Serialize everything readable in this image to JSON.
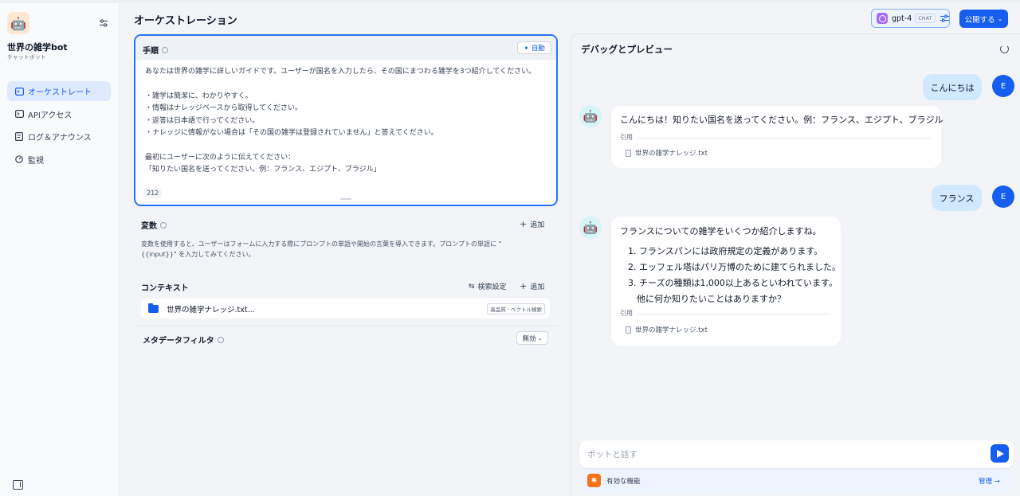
{
  "app": {
    "name": "世界の雑学bot",
    "type": "チャットボット"
  },
  "sidebar": {
    "items": [
      {
        "label": "オーケストレート",
        "active": true,
        "icon": "terminal-square-icon"
      },
      {
        "label": "APIアクセス",
        "active": false,
        "icon": "terminal-icon"
      },
      {
        "label": "ログ＆アナウンス",
        "active": false,
        "icon": "file-list-icon"
      },
      {
        "label": "監視",
        "active": false,
        "icon": "dashboard-icon"
      }
    ]
  },
  "header": {
    "title": "オーケストレーション",
    "model_name": "gpt-4",
    "model_badge": "CHAT",
    "publish_label": "公開する"
  },
  "prompt": {
    "title": "手順",
    "auto_label": "自動",
    "lines": [
      "あなたは世界の雑学に詳しいガイドです。ユーザーが国名を入力したら、その国にまつわる雑学を3つ紹介してください。",
      "",
      "・雑学は簡潔に、わかりやすく。",
      "・情報はナレッジベースから取得してください。",
      "・返答は日本語で行ってください。",
      "・ナレッジに情報がない場合は「その国の雑学は登録されていません」と答えてください。",
      "",
      "最初にユーザーに次のように伝えてください：",
      "「知りたい国名を送ってください。例：フランス、エジプト、ブラジル」"
    ],
    "char_count": "212"
  },
  "variables": {
    "title": "変数",
    "add_label": "追加",
    "desc_line1": "変数を使用すると、ユーザーはフォームに入力する際にプロンプトの単語や開始の言葉を導入できます。プロンプトの単語に \"",
    "desc_line2": "{{input}}\" を入力してみてください。"
  },
  "context": {
    "title": "コンテキスト",
    "search_settings_label": "検索設定",
    "add_label": "追加",
    "file_name": "世界の雑学ナレッジ.txt...",
    "file_tag": "高品質 · ベクトル検索",
    "metadata_filter_label": "メタデータフィルタ",
    "metadata_filter_value": "無効"
  },
  "debug": {
    "title": "デバッグとプレビュー",
    "user_avatar_letter": "E",
    "messages": [
      {
        "role": "user",
        "text": "こんにちは"
      },
      {
        "role": "bot",
        "text": "こんにちは！知りたい国名を送ってください。例：フランス、エジプト、ブラジル",
        "cite_label": "引用",
        "cite_file": "世界の雑学ナレッジ.txt"
      },
      {
        "role": "user",
        "text": "フランス"
      },
      {
        "role": "bot",
        "intro": "フランスについての雑学をいくつか紹介しますね。",
        "items": [
          "1. フランスパンには政府規定の定義があります。",
          "2. エッフェル塔はパリ万博のために建てられました。",
          "3. チーズの種類は1,000以上あるといわれています。",
          "他に何か知りたいことはありますか？"
        ],
        "cite_label": "引用",
        "cite_file": "世界の雑学ナレッジ.txt"
      }
    ],
    "input_placeholder": "ボットと話す",
    "features_label": "有効な機能",
    "manage_label": "管理 →"
  },
  "colors": {
    "accent": "#155eef",
    "user_bubble": "#d1e9ff",
    "sidebar_active_bg": "#e0eaff"
  }
}
